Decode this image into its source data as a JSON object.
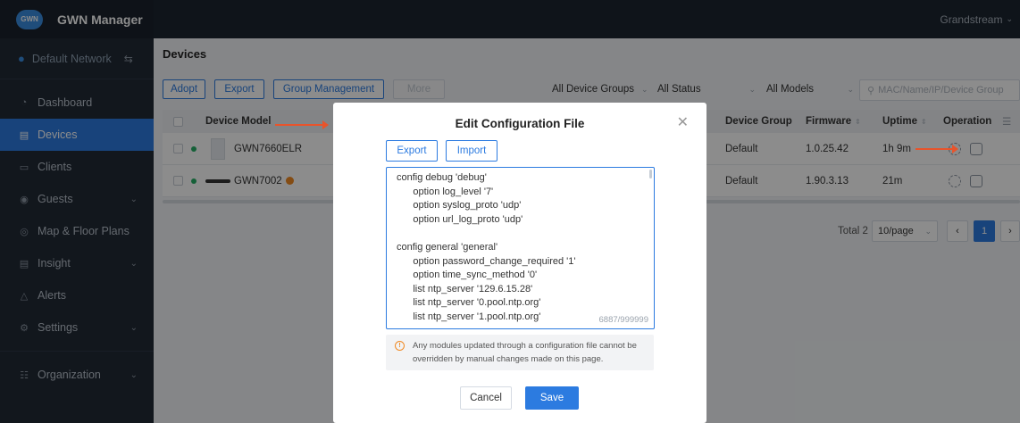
{
  "app": {
    "logo_text": "GWN",
    "title": "GWN Manager",
    "user": "Grandstream"
  },
  "sidebar": {
    "network": "Default Network",
    "items": [
      {
        "label": "Dashboard",
        "icon": "dashboard-icon"
      },
      {
        "label": "Devices",
        "icon": "devices-icon",
        "active": true
      },
      {
        "label": "Clients",
        "icon": "clients-icon"
      },
      {
        "label": "Guests",
        "icon": "guests-icon",
        "chevron": true
      },
      {
        "label": "Map & Floor Plans",
        "icon": "map-icon"
      },
      {
        "label": "Insight",
        "icon": "insight-icon",
        "chevron": true
      },
      {
        "label": "Alerts",
        "icon": "bell-icon"
      },
      {
        "label": "Settings",
        "icon": "gear-icon",
        "chevron": true
      }
    ],
    "org": {
      "label": "Organization",
      "icon": "organization-icon"
    }
  },
  "page": {
    "title": "Devices",
    "toolbar": {
      "adopt": "Adopt",
      "export": "Export",
      "group_management": "Group Management",
      "more": "More",
      "filter_groups": "All Device Groups",
      "filter_status": "All Status",
      "filter_models": "All Models",
      "search_placeholder": "MAC/Name/IP/Device Group"
    },
    "table": {
      "headers": {
        "device_model": "Device Model",
        "device_group": "Device Group",
        "firmware": "Firmware",
        "uptime": "Uptime",
        "operation": "Operation"
      },
      "rows": [
        {
          "model": "GWN7660ELR",
          "group": "Default",
          "firmware": "1.0.25.42",
          "uptime": "1h 9m"
        },
        {
          "model": "GWN7002",
          "group": "Default",
          "firmware": "1.90.3.13",
          "uptime": "21m"
        }
      ]
    },
    "pagination": {
      "total": "Total 2",
      "page_size": "10/page",
      "current": "1"
    }
  },
  "modal": {
    "title": "Edit Configuration File",
    "export": "Export",
    "import": "Import",
    "config_lines": [
      "config debug 'debug'",
      "      option log_level '7'",
      "      option syslog_proto 'udp'",
      "      option url_log_proto 'udp'",
      "",
      "config general 'general'",
      "      option password_change_required '1'",
      "      option time_sync_method '0'",
      "      list ntp_server '129.6.15.28'",
      "      list ntp_server '0.pool.ntp.org'",
      "      list ntp_server '1.pool.ntp.org'"
    ],
    "char_count": "6887/999999",
    "notice_line1": "Any modules updated through a configuration file cannot be",
    "notice_line2": "overridden by manual changes made on this page.",
    "cancel": "Cancel",
    "save": "Save"
  },
  "colors": {
    "accent": "#2c7be0",
    "sidebar_bg": "#222a35",
    "arrow": "#e8542b",
    "online": "#27b066",
    "warning": "#f08a24"
  }
}
